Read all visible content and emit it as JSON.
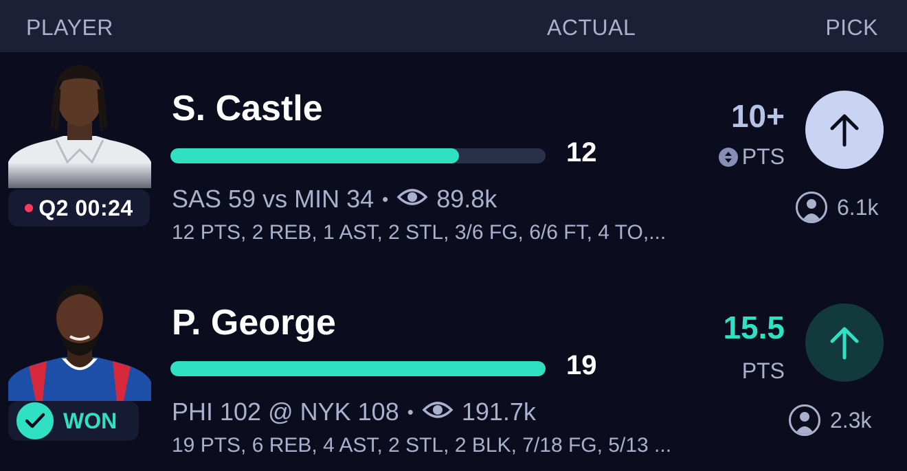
{
  "header": {
    "player": "PLAYER",
    "actual": "ACTUAL",
    "pick": "PICK"
  },
  "rows": [
    {
      "name": "S. Castle",
      "actual": "12",
      "progress": 0.77,
      "status": "Q2 00:24",
      "status_type": "live",
      "game": "SAS 59 vs MIN 34",
      "views": "89.8k",
      "stats": "12 PTS, 2 REB, 1 AST, 2 STL, 3/6 FG, 6/6 FT, 4 TO,...",
      "line": "10+",
      "stat_label": "PTS",
      "pick_direction": "up",
      "picks_count": "6.1k"
    },
    {
      "name": "P. George",
      "actual": "19",
      "progress": 1.0,
      "status": "WON",
      "status_type": "won",
      "game": "PHI 102 @ NYK 108",
      "views": "191.7k",
      "stats": "19 PTS, 6 REB, 4 AST, 2 STL, 2 BLK, 7/18 FG, 5/13 ...",
      "line": "15.5",
      "stat_label": "PTS",
      "pick_direction": "up",
      "picks_count": "2.3k"
    }
  ],
  "colors": {
    "background": "#0b0d1f",
    "header": "#1c2036",
    "accent": "#2fe0c2",
    "live": "#ff3b5c",
    "muted_text": "#a9b1cc"
  }
}
